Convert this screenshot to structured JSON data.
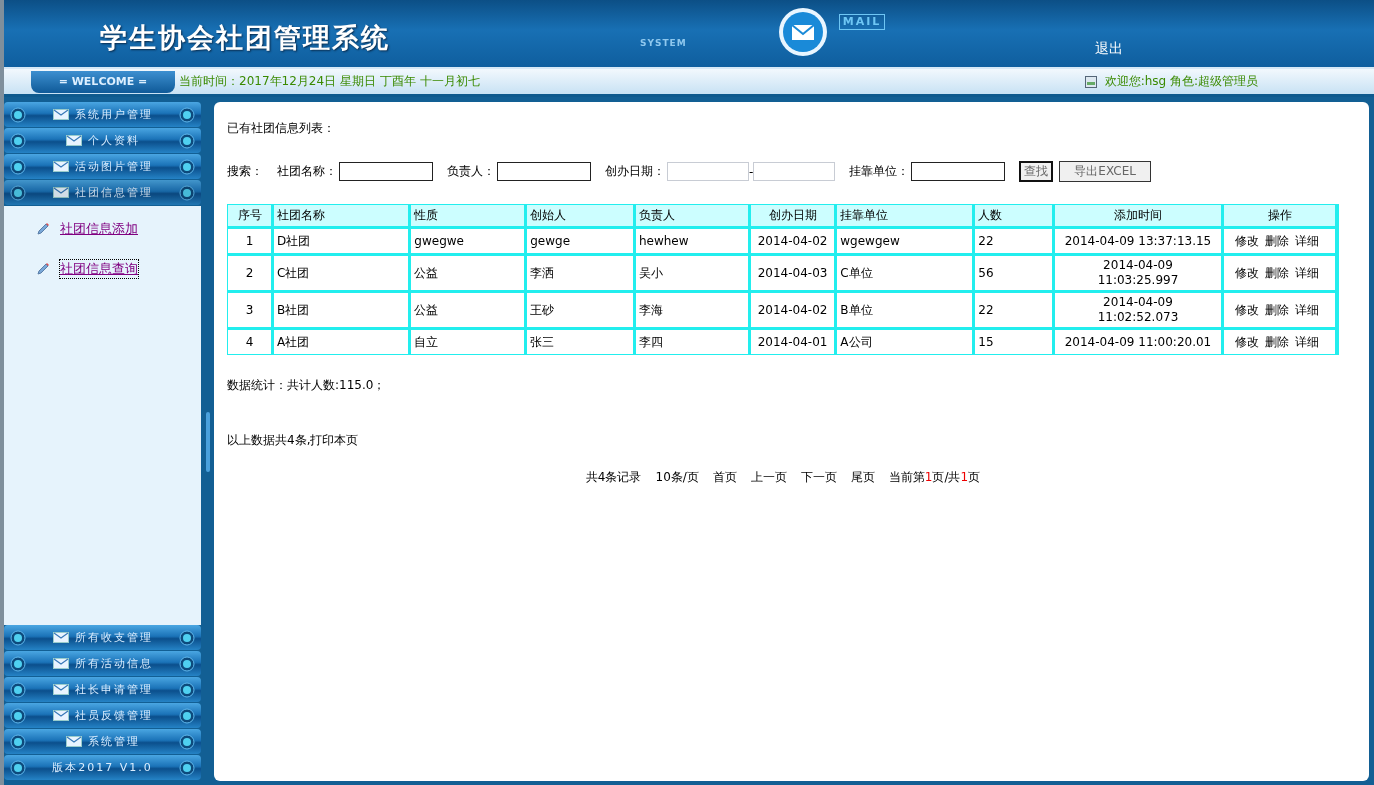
{
  "header": {
    "title": "学生协会社团管理系统",
    "system_label": "SYSTEM",
    "mail_label": "MAIL",
    "logout": "退出"
  },
  "welcome_bar": {
    "badge": "= WELCOME =",
    "datetime": "当前时间：2017年12月24日 星期日 丁酉年 十一月初七",
    "user": "欢迎您:hsg 角色:超级管理员"
  },
  "sidebar": {
    "top_menus": [
      {
        "kind": "menu",
        "label": "系统用户管理",
        "expanded": false
      },
      {
        "kind": "menu",
        "label": "个人资料",
        "expanded": false
      },
      {
        "kind": "menu",
        "label": "活动图片管理",
        "expanded": false
      },
      {
        "kind": "menu",
        "label": "社团信息管理",
        "expanded": true,
        "children": [
          {
            "label": "社团信息添加",
            "selected": false
          },
          {
            "label": "社团信息查询",
            "selected": true
          }
        ]
      }
    ],
    "bottom_menus": [
      {
        "kind": "menu",
        "label": "所有收支管理",
        "expanded": false
      },
      {
        "kind": "menu",
        "label": "所有活动信息",
        "expanded": false
      },
      {
        "kind": "menu",
        "label": "社长申请管理",
        "expanded": false
      },
      {
        "kind": "menu",
        "label": "社员反馈管理",
        "expanded": false
      },
      {
        "kind": "menu",
        "label": "系统管理",
        "expanded": false
      },
      {
        "kind": "version",
        "label": "版本2017 V1.0"
      }
    ]
  },
  "main": {
    "heading": "已有社团信息列表：",
    "search": {
      "label": "搜索：",
      "fields": [
        {
          "kind": "text",
          "label": "社团名称："
        },
        {
          "kind": "text",
          "label": "负责人："
        },
        {
          "kind": "daterange",
          "label": "创办日期：",
          "separator": "-"
        },
        {
          "kind": "text",
          "label": "挂靠单位："
        }
      ],
      "buttons": [
        {
          "label": "查找",
          "focused": true
        },
        {
          "label": "导出EXCEL",
          "focused": false
        }
      ]
    },
    "table": {
      "columns": [
        "序号",
        "社团名称",
        "性质",
        "创始人",
        "负责人",
        "创办日期",
        "挂靠单位",
        "人数",
        "添加时间",
        "操作"
      ],
      "rows": [
        {
          "cells": [
            "1",
            "D社团",
            "gwegwe",
            "gewge",
            "hewhew",
            "2014-04-02",
            "wgewgew",
            "22",
            "2014-04-09 13:37:13.15"
          ],
          "actions": [
            "修改",
            "删除",
            "详细"
          ]
        },
        {
          "cells": [
            "2",
            "C社团",
            "公益",
            "李洒",
            "吴小",
            "2014-04-03",
            "C单位",
            "56",
            "2014-04-09 11:03:25.997"
          ],
          "actions": [
            "修改",
            "删除",
            "详细"
          ]
        },
        {
          "cells": [
            "3",
            "B社团",
            "公益",
            "王砂",
            "李海",
            "2014-04-02",
            "B单位",
            "22",
            "2014-04-09 11:02:52.073"
          ],
          "actions": [
            "修改",
            "删除",
            "详细"
          ]
        },
        {
          "cells": [
            "4",
            "A社团",
            "自立",
            "张三",
            "李四",
            "2014-04-01",
            "A公司",
            "15",
            "2014-04-09 11:00:20.01"
          ],
          "actions": [
            "修改",
            "删除",
            "详细"
          ]
        }
      ]
    },
    "stats": "数据统计：共计人数:115.0；",
    "summary": "以上数据共4条,",
    "print_link": "打印本页",
    "pager": {
      "records": "共4条记录",
      "per_page": "10条/页",
      "links": [
        "首页",
        "上一页",
        "下一页",
        "尾页"
      ],
      "current": {
        "prefix": "当前第",
        "page": "1",
        "middle": "页/共",
        "total": "1",
        "suffix": "页"
      }
    }
  }
}
